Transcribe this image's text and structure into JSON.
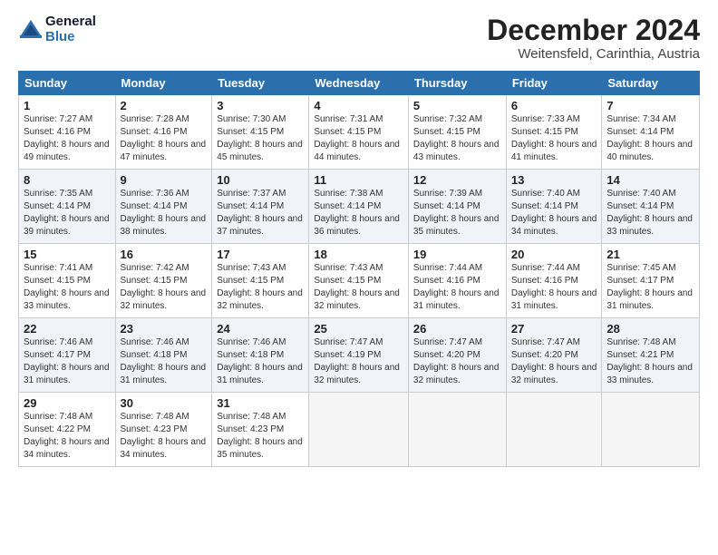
{
  "logo": {
    "line1": "General",
    "line2": "Blue"
  },
  "title": "December 2024",
  "location": "Weitensfeld, Carinthia, Austria",
  "days_of_week": [
    "Sunday",
    "Monday",
    "Tuesday",
    "Wednesday",
    "Thursday",
    "Friday",
    "Saturday"
  ],
  "weeks": [
    [
      {
        "day": "1",
        "sunrise": "7:27 AM",
        "sunset": "4:16 PM",
        "daylight": "8 hours and 49 minutes."
      },
      {
        "day": "2",
        "sunrise": "7:28 AM",
        "sunset": "4:16 PM",
        "daylight": "8 hours and 47 minutes."
      },
      {
        "day": "3",
        "sunrise": "7:30 AM",
        "sunset": "4:15 PM",
        "daylight": "8 hours and 45 minutes."
      },
      {
        "day": "4",
        "sunrise": "7:31 AM",
        "sunset": "4:15 PM",
        "daylight": "8 hours and 44 minutes."
      },
      {
        "day": "5",
        "sunrise": "7:32 AM",
        "sunset": "4:15 PM",
        "daylight": "8 hours and 43 minutes."
      },
      {
        "day": "6",
        "sunrise": "7:33 AM",
        "sunset": "4:15 PM",
        "daylight": "8 hours and 41 minutes."
      },
      {
        "day": "7",
        "sunrise": "7:34 AM",
        "sunset": "4:14 PM",
        "daylight": "8 hours and 40 minutes."
      }
    ],
    [
      {
        "day": "8",
        "sunrise": "7:35 AM",
        "sunset": "4:14 PM",
        "daylight": "8 hours and 39 minutes."
      },
      {
        "day": "9",
        "sunrise": "7:36 AM",
        "sunset": "4:14 PM",
        "daylight": "8 hours and 38 minutes."
      },
      {
        "day": "10",
        "sunrise": "7:37 AM",
        "sunset": "4:14 PM",
        "daylight": "8 hours and 37 minutes."
      },
      {
        "day": "11",
        "sunrise": "7:38 AM",
        "sunset": "4:14 PM",
        "daylight": "8 hours and 36 minutes."
      },
      {
        "day": "12",
        "sunrise": "7:39 AM",
        "sunset": "4:14 PM",
        "daylight": "8 hours and 35 minutes."
      },
      {
        "day": "13",
        "sunrise": "7:40 AM",
        "sunset": "4:14 PM",
        "daylight": "8 hours and 34 minutes."
      },
      {
        "day": "14",
        "sunrise": "7:40 AM",
        "sunset": "4:14 PM",
        "daylight": "8 hours and 33 minutes."
      }
    ],
    [
      {
        "day": "15",
        "sunrise": "7:41 AM",
        "sunset": "4:15 PM",
        "daylight": "8 hours and 33 minutes."
      },
      {
        "day": "16",
        "sunrise": "7:42 AM",
        "sunset": "4:15 PM",
        "daylight": "8 hours and 32 minutes."
      },
      {
        "day": "17",
        "sunrise": "7:43 AM",
        "sunset": "4:15 PM",
        "daylight": "8 hours and 32 minutes."
      },
      {
        "day": "18",
        "sunrise": "7:43 AM",
        "sunset": "4:15 PM",
        "daylight": "8 hours and 32 minutes."
      },
      {
        "day": "19",
        "sunrise": "7:44 AM",
        "sunset": "4:16 PM",
        "daylight": "8 hours and 31 minutes."
      },
      {
        "day": "20",
        "sunrise": "7:44 AM",
        "sunset": "4:16 PM",
        "daylight": "8 hours and 31 minutes."
      },
      {
        "day": "21",
        "sunrise": "7:45 AM",
        "sunset": "4:17 PM",
        "daylight": "8 hours and 31 minutes."
      }
    ],
    [
      {
        "day": "22",
        "sunrise": "7:46 AM",
        "sunset": "4:17 PM",
        "daylight": "8 hours and 31 minutes."
      },
      {
        "day": "23",
        "sunrise": "7:46 AM",
        "sunset": "4:18 PM",
        "daylight": "8 hours and 31 minutes."
      },
      {
        "day": "24",
        "sunrise": "7:46 AM",
        "sunset": "4:18 PM",
        "daylight": "8 hours and 31 minutes."
      },
      {
        "day": "25",
        "sunrise": "7:47 AM",
        "sunset": "4:19 PM",
        "daylight": "8 hours and 32 minutes."
      },
      {
        "day": "26",
        "sunrise": "7:47 AM",
        "sunset": "4:20 PM",
        "daylight": "8 hours and 32 minutes."
      },
      {
        "day": "27",
        "sunrise": "7:47 AM",
        "sunset": "4:20 PM",
        "daylight": "8 hours and 32 minutes."
      },
      {
        "day": "28",
        "sunrise": "7:48 AM",
        "sunset": "4:21 PM",
        "daylight": "8 hours and 33 minutes."
      }
    ],
    [
      {
        "day": "29",
        "sunrise": "7:48 AM",
        "sunset": "4:22 PM",
        "daylight": "8 hours and 34 minutes."
      },
      {
        "day": "30",
        "sunrise": "7:48 AM",
        "sunset": "4:23 PM",
        "daylight": "8 hours and 34 minutes."
      },
      {
        "day": "31",
        "sunrise": "7:48 AM",
        "sunset": "4:23 PM",
        "daylight": "8 hours and 35 minutes."
      },
      null,
      null,
      null,
      null
    ]
  ]
}
